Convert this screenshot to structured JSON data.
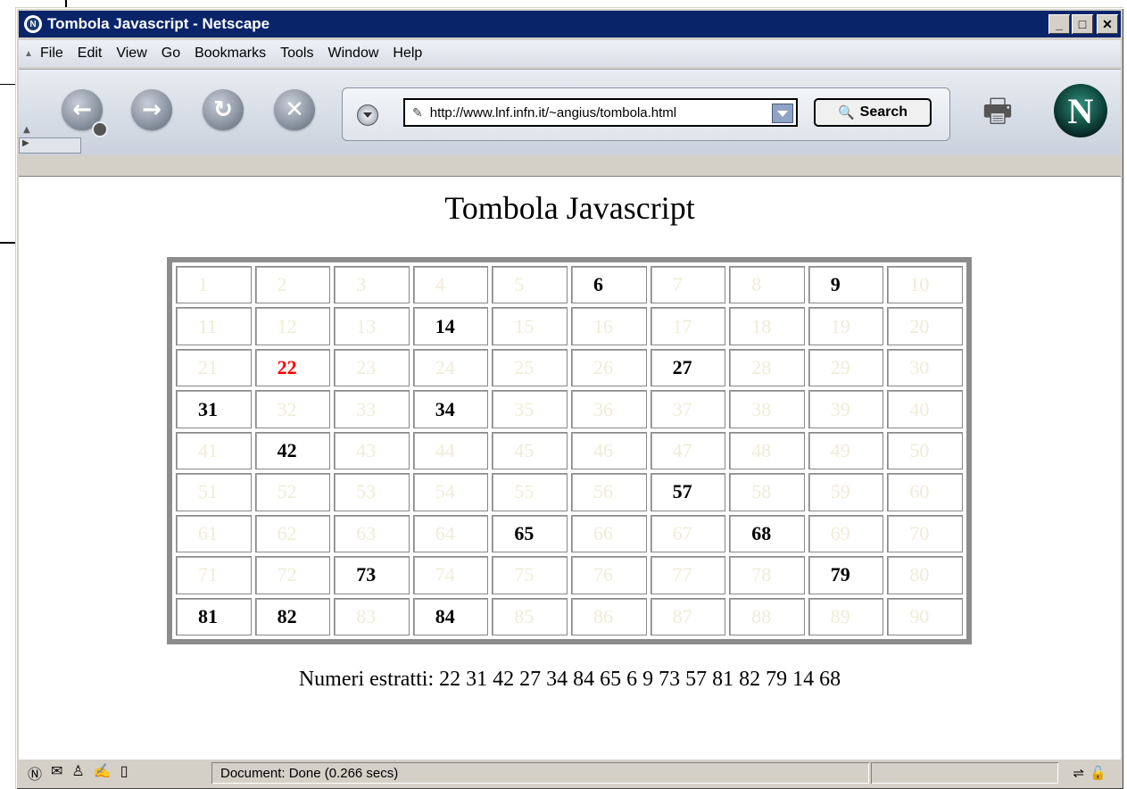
{
  "window": {
    "title": "Tombola Javascript - Netscape"
  },
  "menu": [
    "File",
    "Edit",
    "View",
    "Go",
    "Bookmarks",
    "Tools",
    "Window",
    "Help"
  ],
  "menu_underline": [
    "F",
    "E",
    "V",
    "G",
    "B",
    "T",
    "W",
    "H"
  ],
  "nav": {
    "url": "http://www.lnf.infn.it/~angius/tombola.html",
    "search_label": "Search"
  },
  "page": {
    "title": "Tombola Javascript",
    "drawn_label": "Numeri estratti:",
    "drawn_numbers": "22 31 42 27 34 84 65 6 9 73 57 81 82 79 14 68"
  },
  "board": {
    "numbers_start": 1,
    "numbers_end": 90,
    "drawn": [
      22,
      31,
      42,
      27,
      34,
      84,
      65,
      6,
      9,
      73,
      57,
      81,
      82,
      79,
      14,
      68
    ],
    "last_drawn": 22,
    "colors": {
      "drawn": "#000000",
      "last": "#ff0000",
      "undrawn": "#f0ecd8"
    }
  },
  "status": {
    "text": "Document: Done (0.266 secs)"
  }
}
